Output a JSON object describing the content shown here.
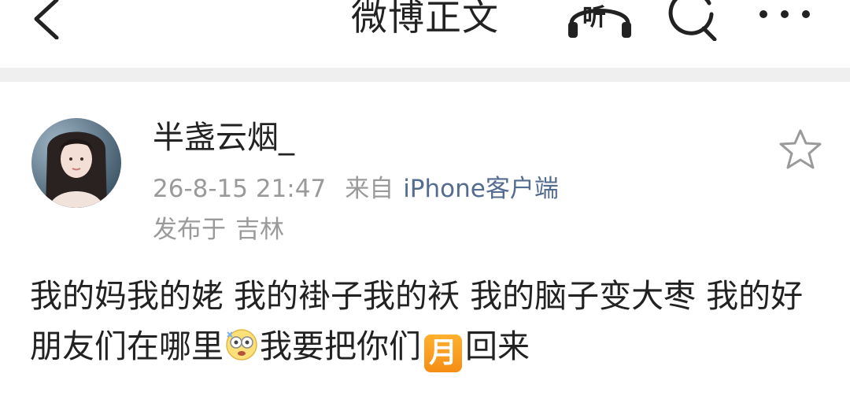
{
  "header": {
    "title": "微博正文",
    "listen_label": "听",
    "icons": {
      "back": "chevron-left-icon",
      "listen": "headphones-icon",
      "search": "search-icon",
      "more": "more-dots-icon"
    }
  },
  "post": {
    "username": "半盏云烟_",
    "time": "26-8-15 21:47",
    "source_label": "来自",
    "source": "iPhone客户端",
    "location_label": "发布于",
    "location": "吉林",
    "body": {
      "text_part1": "我的妈我的姥 我的褂子我的袄 我的脑子变大枣 我的好朋友们在哪里",
      "emoji_name": "dizzy-face-emoji",
      "text_part2": "我要把你们",
      "badge_text": "月",
      "text_part3": "回来"
    },
    "favorite_icon": "star-outline-icon"
  },
  "colors": {
    "text_primary": "#222222",
    "text_secondary": "#9a9a9a",
    "link": "#536c8f",
    "divider": "#efefef",
    "badge_orange": "#f59a1f"
  }
}
